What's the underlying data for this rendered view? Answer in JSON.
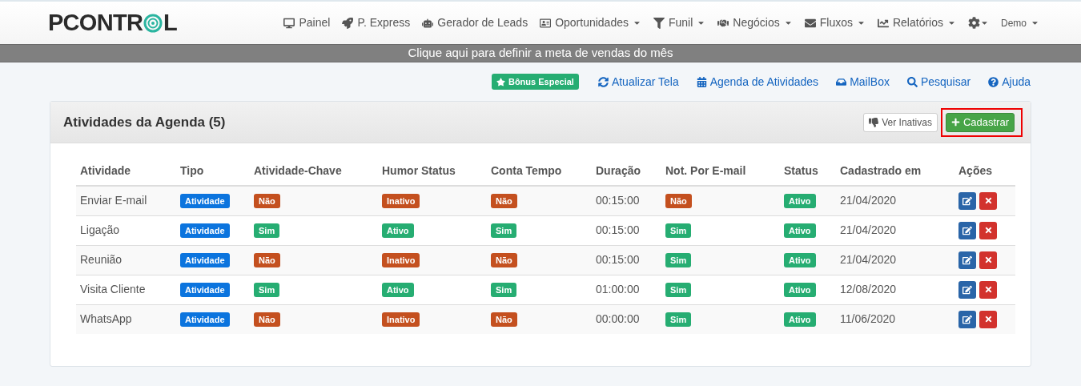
{
  "logo": {
    "before": "PCONTR",
    "after": "L"
  },
  "nav": [
    {
      "label": "Painel",
      "dropdown": false
    },
    {
      "label": "P. Express",
      "dropdown": false
    },
    {
      "label": "Gerador de Leads",
      "dropdown": false
    },
    {
      "label": "Oportunidades",
      "dropdown": true
    },
    {
      "label": "Funil",
      "dropdown": true
    },
    {
      "label": "Negócios",
      "dropdown": true
    },
    {
      "label": "Fluxos",
      "dropdown": true
    },
    {
      "label": "Relatórios",
      "dropdown": true
    }
  ],
  "settings_menu": {
    "dropdown": true
  },
  "user_menu": {
    "label": "Demo",
    "dropdown": true
  },
  "goal_banner": "Clique aqui para definir a meta de vendas do mês",
  "toolbar": {
    "badge": "Bônus Especial",
    "links": [
      "Atualizar Tela",
      "Agenda de Atividades",
      "MailBox",
      "Pesquisar",
      "Ajuda"
    ]
  },
  "panel": {
    "title": "Atividades da Agenda (5)",
    "inactive_button": "Ver Inativas",
    "add_button": {
      "label": "Cadastrar",
      "highlighted": true
    }
  },
  "table": {
    "columns": [
      "Atividade",
      "Tipo",
      "Atividade-Chave",
      "Humor Status",
      "Conta Tempo",
      "Duração",
      "Not. Por E-mail",
      "Status",
      "Cadastrado em",
      "Ações"
    ],
    "rows": [
      {
        "name": "Enviar E-mail",
        "type": {
          "text": "Atividade",
          "color": "#0b74de"
        },
        "key": {
          "text": "Não",
          "color": "#c4501f"
        },
        "humor": {
          "text": "Inativo",
          "color": "#c4501f"
        },
        "timer": {
          "text": "Não",
          "color": "#c4501f"
        },
        "duration": "00:15:00",
        "email": {
          "text": "Não",
          "color": "#c4501f"
        },
        "status": {
          "text": "Ativo",
          "color": "#26ad72"
        },
        "created": "21/04/2020"
      },
      {
        "name": "Ligação",
        "type": {
          "text": "Atividade",
          "color": "#0b74de"
        },
        "key": {
          "text": "Sim",
          "color": "#26ad72"
        },
        "humor": {
          "text": "Ativo",
          "color": "#26ad72"
        },
        "timer": {
          "text": "Sim",
          "color": "#26ad72"
        },
        "duration": "00:15:00",
        "email": {
          "text": "Sim",
          "color": "#26ad72"
        },
        "status": {
          "text": "Ativo",
          "color": "#26ad72"
        },
        "created": "21/04/2020"
      },
      {
        "name": "Reunião",
        "type": {
          "text": "Atividade",
          "color": "#0b74de"
        },
        "key": {
          "text": "Não",
          "color": "#c4501f"
        },
        "humor": {
          "text": "Inativo",
          "color": "#c4501f"
        },
        "timer": {
          "text": "Não",
          "color": "#c4501f"
        },
        "duration": "00:15:00",
        "email": {
          "text": "Sim",
          "color": "#26ad72"
        },
        "status": {
          "text": "Ativo",
          "color": "#26ad72"
        },
        "created": "21/04/2020"
      },
      {
        "name": "Visita Cliente",
        "type": {
          "text": "Atividade",
          "color": "#0b74de"
        },
        "key": {
          "text": "Sim",
          "color": "#26ad72"
        },
        "humor": {
          "text": "Ativo",
          "color": "#26ad72"
        },
        "timer": {
          "text": "Sim",
          "color": "#26ad72"
        },
        "duration": "01:00:00",
        "email": {
          "text": "Sim",
          "color": "#26ad72"
        },
        "status": {
          "text": "Ativo",
          "color": "#26ad72"
        },
        "created": "12/08/2020"
      },
      {
        "name": "WhatsApp",
        "type": {
          "text": "Atividade",
          "color": "#0b74de"
        },
        "key": {
          "text": "Não",
          "color": "#c4501f"
        },
        "humor": {
          "text": "Inativo",
          "color": "#c4501f"
        },
        "timer": {
          "text": "Não",
          "color": "#c4501f"
        },
        "duration": "00:00:00",
        "email": {
          "text": "Sim",
          "color": "#26ad72"
        },
        "status": {
          "text": "Ativo",
          "color": "#26ad72"
        },
        "created": "11/06/2020"
      }
    ]
  }
}
